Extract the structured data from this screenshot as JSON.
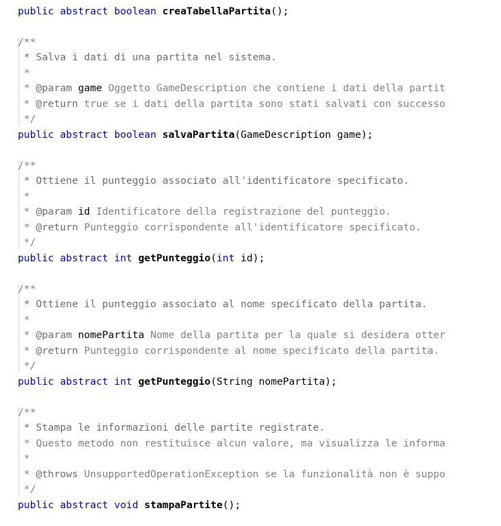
{
  "colors": {
    "keyword": "#0000c0",
    "comment": "#808080",
    "background": "#ffffff",
    "text": "#000000"
  },
  "code": {
    "m1": {
      "kw1": "public",
      "kw2": "abstract",
      "ret": "boolean",
      "name": "creaTabellaPartita",
      "tail": "();"
    },
    "doc2": {
      "open": "/**",
      "desc": " * Salva i dati di una partita nel sistema.",
      "blank": " *",
      "param_prefix": " * ",
      "param_tag": "@param",
      "param_name": "game",
      "param_desc": " Oggetto GameDescription che contiene i dati della partit",
      "return_prefix": " * ",
      "return_tag": "@return",
      "return_desc": " true se i dati della partita sono stati salvati con successo",
      "close": " */"
    },
    "m2": {
      "kw1": "public",
      "kw2": "abstract",
      "ret": "boolean",
      "name": "salvaPartita",
      "tail": "(GameDescription game);"
    },
    "doc3": {
      "open": "/**",
      "desc": " * Ottiene il punteggio associato all'identificatore specificato.",
      "blank": " *",
      "param_prefix": " * ",
      "param_tag": "@param",
      "param_name": "id",
      "param_desc": " Identificatore della registrazione del punteggio.",
      "return_prefix": " * ",
      "return_tag": "@return",
      "return_desc": " Punteggio corrispondente all'identificatore specificato.",
      "close": " */"
    },
    "m3": {
      "kw1": "public",
      "kw2": "abstract",
      "ret": "int",
      "name": "getPunteggio",
      "open_paren": "(",
      "param_type": "int",
      "tail": " id);"
    },
    "doc4": {
      "open": "/**",
      "desc": " * Ottiene il punteggio associato al nome specificato della partita.",
      "blank": " *",
      "param_prefix": " * ",
      "param_tag": "@param",
      "param_name": "nomePartita",
      "param_desc": " Nome della partita per la quale si desidera otter",
      "return_prefix": " * ",
      "return_tag": "@return",
      "return_desc": " Punteggio corrispondente al nome specificato della partita.",
      "close": " */"
    },
    "m4": {
      "kw1": "public",
      "kw2": "abstract",
      "ret": "int",
      "name": "getPunteggio",
      "tail": "(String nomePartita);"
    },
    "doc5": {
      "open": "/**",
      "desc1": " * Stampa le informazioni delle partite registrate.",
      "desc2": " * Questo metodo non restituisce alcun valore, ma visualizza le informa",
      "blank": " *",
      "throws_prefix": " * ",
      "throws_tag": "@throws",
      "throws_desc": " UnsupportedOperationException se la funzionalità non è suppo",
      "close": " */"
    },
    "m5": {
      "kw1": "public",
      "kw2": "abstract",
      "ret": "void",
      "name": "stampaPartite",
      "tail": "();"
    },
    "space": " "
  }
}
